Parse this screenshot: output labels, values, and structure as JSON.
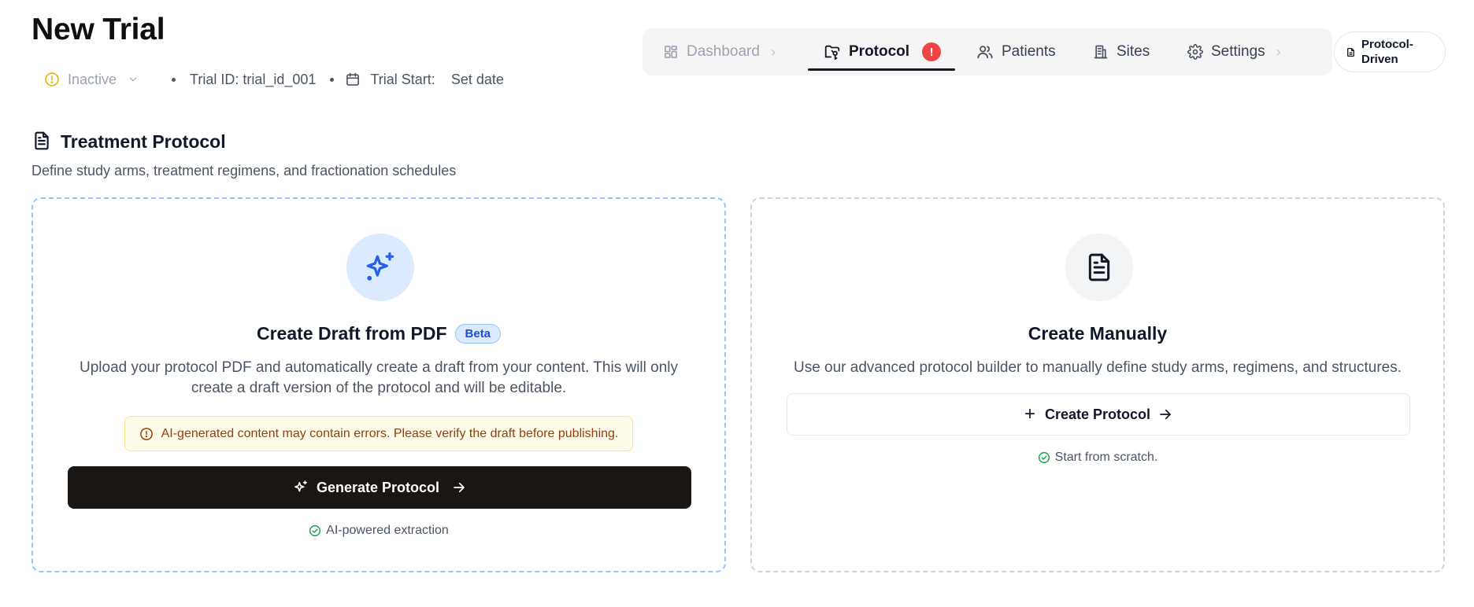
{
  "header": {
    "title": "New Trial",
    "status": "Inactive",
    "trial_id": "Trial ID: trial_id_001",
    "trial_start_label": "Trial Start:",
    "trial_start_value": "Set date"
  },
  "nav": {
    "items": [
      {
        "label": "Dashboard",
        "icon": "dashboard-icon",
        "state": "disabled"
      },
      {
        "label": "Protocol",
        "icon": "protocol-icon",
        "state": "active",
        "badge": "!"
      },
      {
        "label": "Patients",
        "icon": "users-icon",
        "state": "normal"
      },
      {
        "label": "Sites",
        "icon": "building-icon",
        "state": "normal"
      },
      {
        "label": "Settings",
        "icon": "gear-icon",
        "state": "normal"
      }
    ],
    "mode_line1": "Protocol-",
    "mode_line2": "Driven"
  },
  "section": {
    "title": "Treatment Protocol",
    "subtitle": "Define study arms, treatment regimens, and fractionation schedules"
  },
  "ai_card": {
    "title": "Create Draft from PDF",
    "badge": "Beta",
    "description": "Upload your protocol PDF and automatically create a draft from your content. This will only create a draft version of the protocol and will be editable.",
    "warning": "AI-generated content may contain errors. Please verify the draft before publishing.",
    "button_label": "Generate Protocol",
    "footnote": "AI-powered extraction"
  },
  "manual_card": {
    "title": "Create Manually",
    "description": "Use our advanced protocol builder to manually define study arms, regimens, and structures.",
    "button_label": "Create Protocol",
    "footnote": "Start from scratch."
  },
  "colors": {
    "accent_blue": "#2563eb",
    "warning_amber": "#eab308",
    "alert_red": "#ef4444",
    "success_green": "#16a34a",
    "primary_button": "#1a1614"
  }
}
